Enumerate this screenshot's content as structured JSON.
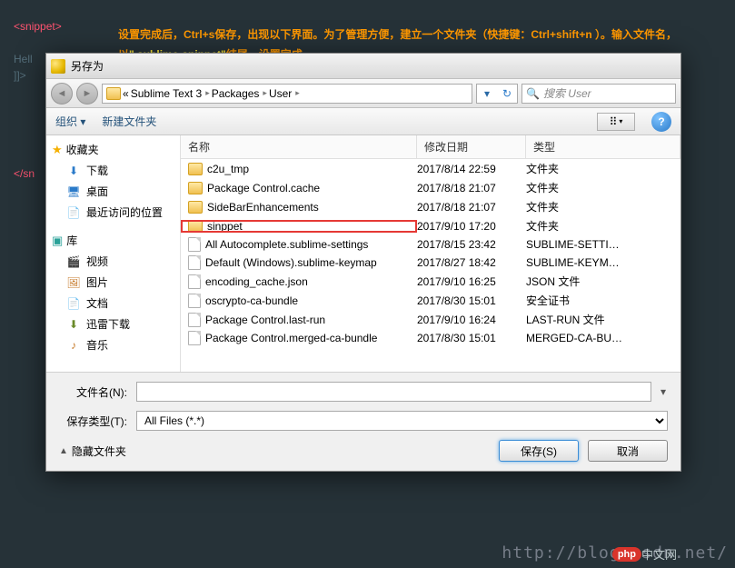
{
  "code": {
    "l1a": "<",
    "l1b": "snippet",
    "l1c": ">",
    "l2": "Hell",
    "l3": "]]>",
    "l4a": "</",
    "l4b": "sn"
  },
  "annotation": {
    "text_a": "设置完成后，Ctrl+s保存，出现以下界面。为了管理方便，建立一个文件夹（快捷键：Ctrl+shift+n ）。输入文件名，以",
    "text_b": "\".sublime-snippet\"",
    "text_c": "结尾，设置完成"
  },
  "dialog": {
    "title": "另存为",
    "breadcrumb": {
      "sep": "«",
      "p1": "Sublime Text 3",
      "p2": "Packages",
      "p3": "User"
    },
    "search_placeholder": "搜索 User",
    "toolbar": {
      "organize": "组织 ▾",
      "newfolder": "新建文件夹"
    },
    "cols": {
      "name": "名称",
      "date": "修改日期",
      "type": "类型"
    },
    "left": {
      "fav": "收藏夹",
      "items1": [
        {
          "icon": "dl",
          "label": "下载"
        },
        {
          "icon": "dk",
          "label": "桌面"
        },
        {
          "icon": "rc",
          "label": "最近访问的位置"
        }
      ],
      "lib": "库",
      "items2": [
        {
          "icon": "vd",
          "label": "视频"
        },
        {
          "icon": "im",
          "label": "图片"
        },
        {
          "icon": "dc",
          "label": "文档"
        },
        {
          "icon": "xl",
          "label": "迅雷下载"
        }
      ],
      "music": "音乐"
    },
    "rows": [
      {
        "kind": "folder",
        "name": "c2u_tmp",
        "date": "2017/8/14 22:59",
        "type": "文件夹",
        "hl": false
      },
      {
        "kind": "folder",
        "name": "Package Control.cache",
        "date": "2017/8/18 21:07",
        "type": "文件夹",
        "hl": false
      },
      {
        "kind": "folder",
        "name": "SideBarEnhancements",
        "date": "2017/8/18 21:07",
        "type": "文件夹",
        "hl": false
      },
      {
        "kind": "folder",
        "name": "sinppet",
        "date": "2017/9/10 17:20",
        "type": "文件夹",
        "hl": true
      },
      {
        "kind": "file",
        "name": "All Autocomplete.sublime-settings",
        "date": "2017/8/15 23:42",
        "type": "SUBLIME-SETTI…",
        "hl": false
      },
      {
        "kind": "file",
        "name": "Default (Windows).sublime-keymap",
        "date": "2017/8/27 18:42",
        "type": "SUBLIME-KEYM…",
        "hl": false
      },
      {
        "kind": "file",
        "name": "encoding_cache.json",
        "date": "2017/9/10 16:25",
        "type": "JSON 文件",
        "hl": false
      },
      {
        "kind": "file",
        "name": "oscrypto-ca-bundle",
        "date": "2017/8/30 15:01",
        "type": "安全证书",
        "hl": false
      },
      {
        "kind": "file",
        "name": "Package Control.last-run",
        "date": "2017/9/10 16:24",
        "type": "LAST-RUN 文件",
        "hl": false
      },
      {
        "kind": "file",
        "name": "Package Control.merged-ca-bundle",
        "date": "2017/8/30 15:01",
        "type": "MERGED-CA-BU…",
        "hl": false
      }
    ],
    "filename_label": "文件名(N):",
    "filetype_label": "保存类型(T):",
    "filetype_value": "All Files (*.*)",
    "hide_folders": "隐藏文件夹",
    "save": "保存(S)",
    "cancel": "取消"
  },
  "watermark": {
    "url": "http://blog.csdn.net/",
    "badge": "php",
    "cn": "中文网"
  }
}
